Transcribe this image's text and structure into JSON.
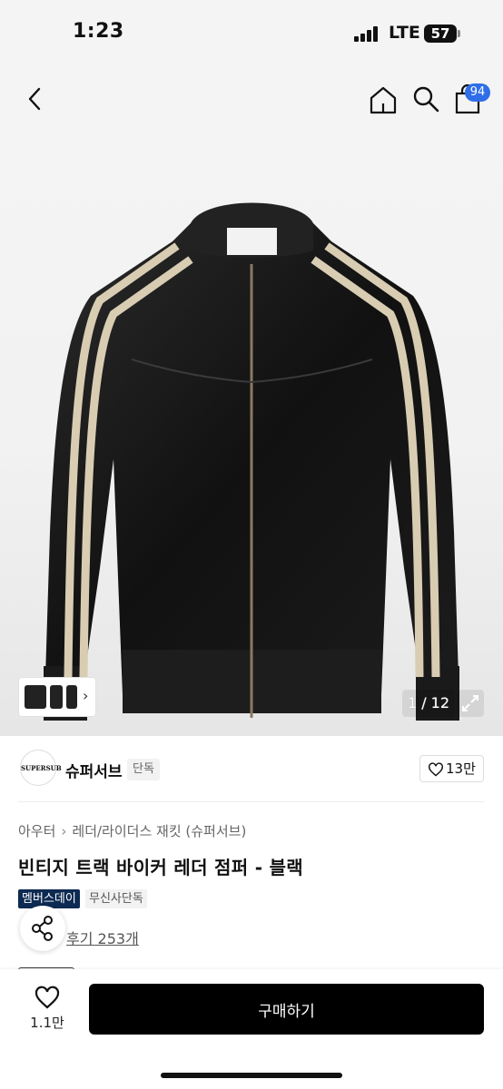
{
  "status_bar": {
    "time": "1:23",
    "network": "LTE",
    "battery": "57"
  },
  "header": {
    "cart_count": "94",
    "icons": [
      "back-icon",
      "home-icon",
      "search-icon",
      "shopping-bag-icon"
    ]
  },
  "gallery": {
    "counter": "1 / 12",
    "thumbnail_arrow": "›"
  },
  "brand": {
    "logo_text": "SUPERSUB",
    "name": "슈퍼서브",
    "tag": "단독",
    "like_count": "13만"
  },
  "product": {
    "breadcrumb": [
      "아우터",
      "레더/라이더스 재킷 (슈퍼서브)"
    ],
    "title": "빈티지 트랙 바이커 레더 점퍼 - 블랙",
    "badges": [
      "멤버스데이",
      "무신사단독"
    ],
    "reviews": "후기 253개"
  },
  "bottom_bar": {
    "wish_count": "1.1만",
    "buy_label": "구매하기"
  },
  "colors": {
    "accent_badge": "#2f6ee8",
    "member_badge": "#0d2a52",
    "buy_button": "#000000"
  }
}
